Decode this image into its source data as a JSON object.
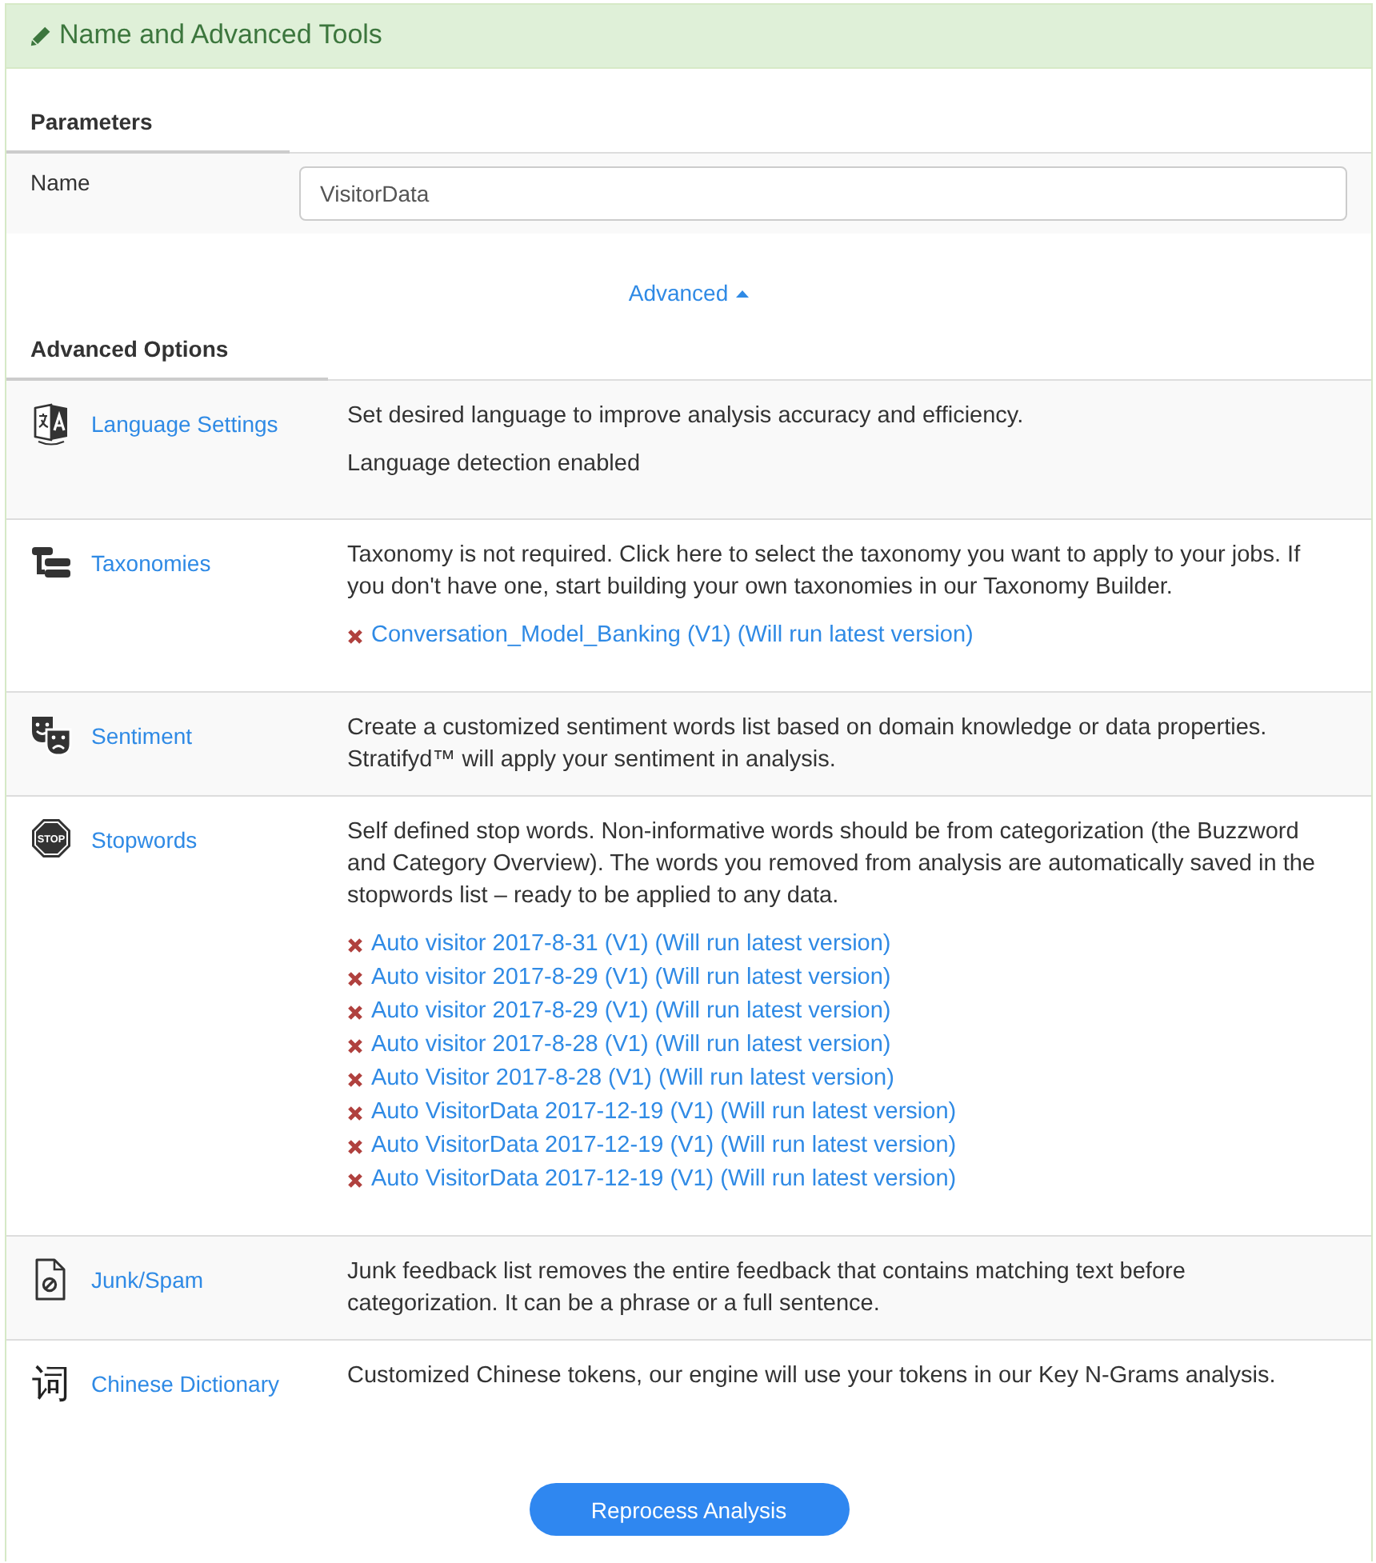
{
  "header": {
    "title": "Name and Advanced Tools"
  },
  "parameters": {
    "heading": "Parameters",
    "fields": [
      {
        "label": "Name",
        "value": "VisitorData"
      }
    ]
  },
  "advanced_toggle": {
    "label": "Advanced",
    "expanded": true
  },
  "advanced_options": {
    "heading": "Advanced Options",
    "rows": [
      {
        "kind": "language",
        "label": "Language Settings",
        "description": "Set desired language to improve analysis accuracy and efficiency.",
        "status": "Language detection enabled"
      },
      {
        "kind": "taxonomy",
        "label": "Taxonomies",
        "description": "Taxonomy is not required. Click here to select the taxonomy you want to apply to your jobs. If you don't have one, start building your own taxonomies in our Taxonomy Builder.",
        "items": [
          "Conversation_Model_Banking (V1) (Will run latest version)"
        ]
      },
      {
        "kind": "sentiment",
        "label": "Sentiment",
        "description": "Create a customized sentiment words list based on domain knowledge or data properties. Stratifyd™ will apply your sentiment in analysis."
      },
      {
        "kind": "stopwords",
        "label": "Stopwords",
        "icon_text": "STOP",
        "description": "Self defined stop words. Non-informative words should be from categorization (the Buzzword and Category Overview). The words you removed from analysis are automatically saved in the stopwords list – ready to be applied to any data.",
        "items": [
          "Auto visitor 2017-8-31 (V1) (Will run latest version)",
          "Auto visitor 2017-8-29 (V1) (Will run latest version)",
          "Auto visitor 2017-8-29 (V1) (Will run latest version)",
          "Auto visitor 2017-8-28 (V1) (Will run latest version)",
          "Auto Visitor 2017-8-28 (V1) (Will run latest version)",
          "Auto VisitorData 2017-12-19 (V1) (Will run latest version)",
          "Auto VisitorData 2017-12-19 (V1) (Will run latest version)",
          "Auto VisitorData 2017-12-19 (V1) (Will run latest version)"
        ]
      },
      {
        "kind": "junk",
        "label": "Junk/Spam",
        "description": "Junk feedback list removes the entire feedback that contains matching text before categorization. It can be a phrase or a full sentence."
      },
      {
        "kind": "dictionary",
        "label": "Chinese Dictionary",
        "icon_text": "词",
        "description": "Customized Chinese tokens, our engine will use your tokens in our Key N-Grams analysis."
      }
    ]
  },
  "primary_button": {
    "label": "Reprocess Analysis"
  }
}
